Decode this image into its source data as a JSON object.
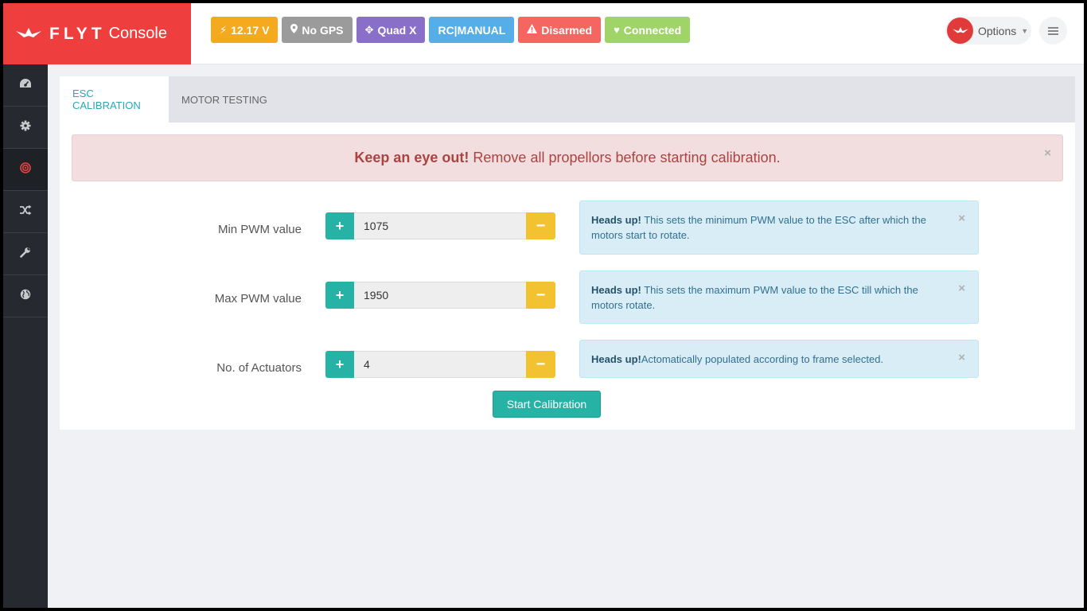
{
  "brand": {
    "name": "FLYT",
    "suffix": "Console"
  },
  "status": {
    "voltage": "12.17 V",
    "gps": "No GPS",
    "frame": "Quad X",
    "mode": "RC|MANUAL",
    "arm": "Disarmed",
    "connection": "Connected"
  },
  "colors": {
    "brand": "#ef3e3e",
    "voltage": "#f5a91e",
    "gps": "#9b9b9b",
    "frame": "#8a6fc9",
    "mode": "#55aee8",
    "arm": "#f4665f",
    "connection": "#a0d468",
    "plus": "#26b2a4",
    "minus": "#f2c230"
  },
  "header": {
    "options_label": "Options"
  },
  "sidebar": {
    "items": [
      {
        "icon": "dashboard-icon"
      },
      {
        "icon": "gear-icon"
      },
      {
        "icon": "target-icon"
      },
      {
        "icon": "shuffle-icon"
      },
      {
        "icon": "wrench-icon"
      },
      {
        "icon": "globe-icon"
      }
    ]
  },
  "tabs": [
    {
      "label": "ESC CALIBRATION",
      "active": true
    },
    {
      "label": "MOTOR TESTING",
      "active": false
    }
  ],
  "warning": {
    "title": "Keep an eye out!",
    "text": "Remove all propellors before starting calibration."
  },
  "fields": [
    {
      "label": "Min PWM value",
      "value": "1075",
      "info_title": "Heads up!",
      "info_text": " This sets the minimum PWM value to the ESC after which the motors start to rotate."
    },
    {
      "label": "Max PWM value",
      "value": "1950",
      "info_title": "Heads up!",
      "info_text": " This sets the maximum PWM value to the ESC till which the motors rotate."
    },
    {
      "label": "No. of Actuators",
      "value": "4",
      "info_title": "Heads up!",
      "info_text": "Actomatically populated according to frame selected."
    }
  ],
  "start_button": "Start Calibration"
}
